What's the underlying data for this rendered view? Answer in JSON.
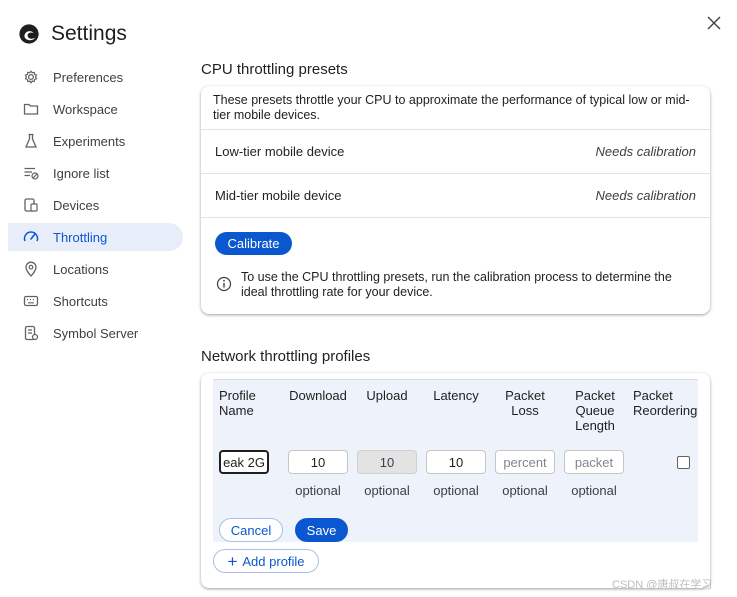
{
  "app": {
    "title": "Settings",
    "close_label": "×"
  },
  "sidebar": {
    "items": [
      {
        "label": "Preferences",
        "icon": "gear-icon"
      },
      {
        "label": "Workspace",
        "icon": "folder-icon"
      },
      {
        "label": "Experiments",
        "icon": "flask-icon"
      },
      {
        "label": "Ignore list",
        "icon": "ignore-list-icon"
      },
      {
        "label": "Devices",
        "icon": "devices-icon"
      },
      {
        "label": "Throttling",
        "icon": "speedometer-icon",
        "active": true
      },
      {
        "label": "Locations",
        "icon": "location-pin-icon"
      },
      {
        "label": "Shortcuts",
        "icon": "keyboard-icon"
      },
      {
        "label": "Symbol Server",
        "icon": "symbol-server-icon"
      }
    ]
  },
  "cpu": {
    "section_title": "CPU throttling presets",
    "description": "These presets throttle your CPU to approximate the performance of typical low or mid-tier mobile devices.",
    "rows": [
      {
        "name": "Low-tier mobile device",
        "status": "Needs calibration"
      },
      {
        "name": "Mid-tier mobile device",
        "status": "Needs calibration"
      }
    ],
    "calibrate_label": "Calibrate",
    "info_text": "To use the CPU throttling presets, run the calibration process to determine the ideal throttling rate for your device."
  },
  "network": {
    "section_title": "Network throttling profiles",
    "headers": {
      "profile_name": "Profile Name",
      "download": "Download",
      "upload": "Upload",
      "latency": "Latency",
      "packet_loss": "Packet Loss",
      "packet_queue": "Packet Queue Length",
      "packet_reordering": "Packet Reordering"
    },
    "inputs": {
      "profile_name": "eak 2G",
      "download": "10",
      "upload": "10",
      "latency": "10",
      "packet_loss_placeholder": "percent",
      "packet_queue_placeholder": "packet"
    },
    "optional_label": "optional",
    "cancel_label": "Cancel",
    "save_label": "Save",
    "add_profile_label": "Add profile"
  },
  "watermark": "CSDN @唐叔在学习",
  "colors": {
    "accent": "#0b57d0",
    "active_bg": "#e8eef9",
    "table_bg": "#eef2fa"
  }
}
